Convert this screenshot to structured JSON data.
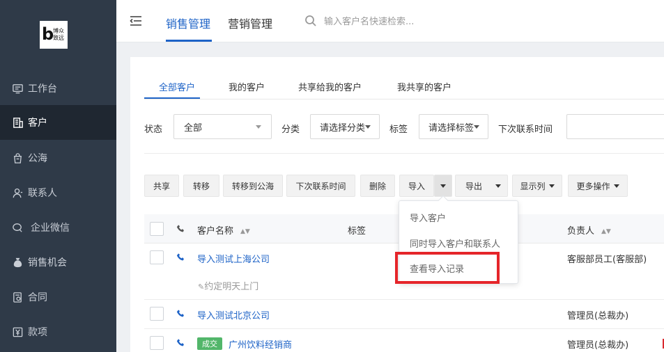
{
  "brand": {
    "mark": "b",
    "line1": "博众",
    "line2": "致远"
  },
  "sidebar": {
    "items": [
      {
        "label": "工作台",
        "icon": "monitor-icon"
      },
      {
        "label": "客户",
        "icon": "building-icon",
        "active": true
      },
      {
        "label": "公海",
        "icon": "bag-icon"
      },
      {
        "label": "联系人",
        "icon": "person-icon"
      },
      {
        "label": "企业微信",
        "icon": "chat-icon"
      },
      {
        "label": "销售机会",
        "icon": "moneybag-icon"
      },
      {
        "label": "合同",
        "icon": "contract-icon"
      },
      {
        "label": "款项",
        "icon": "yen-icon"
      }
    ]
  },
  "header": {
    "tabs": [
      "销售管理",
      "营销管理"
    ],
    "active_tab": "销售管理",
    "search_placeholder": "输入客户名快速检索..."
  },
  "subtabs": [
    "全部客户",
    "我的客户",
    "共享给我的客户",
    "我共享的客户"
  ],
  "filters": {
    "status_label": "状态",
    "status_value": "全部",
    "category_label": "分类",
    "category_value": "请选择分类",
    "tag_label": "标签",
    "tag_value": "请选择标签",
    "next_contact_label": "下次联系时间"
  },
  "toolbar": {
    "share": "共享",
    "transfer": "转移",
    "to_pool": "转移到公海",
    "next_contact": "下次联系时间",
    "delete": "删除",
    "import": "导入",
    "export": "导出",
    "columns": "显示列",
    "more": "更多操作"
  },
  "import_menu": {
    "items": [
      "导入客户",
      "同时导入客户和联系人",
      "查看导入记录"
    ],
    "highlighted": "查看导入记录"
  },
  "table": {
    "headers": {
      "name": "客户名称",
      "tags": "标签",
      "owner": "负责人"
    },
    "rows": [
      {
        "name": "导入测试上海公司",
        "owner": "客服部员工(客服部)",
        "note": "约定明天上门"
      },
      {
        "name": "导入测试北京公司",
        "owner": "管理员(总裁办)"
      },
      {
        "name": "广州饮料经销商",
        "owner": "管理员(总裁办)",
        "badge": "成交"
      }
    ]
  },
  "colors": {
    "accent": "#1e63c7",
    "sidebar_bg": "#2f3a48",
    "badge": "#52b66a",
    "highlight": "#e5252a"
  }
}
